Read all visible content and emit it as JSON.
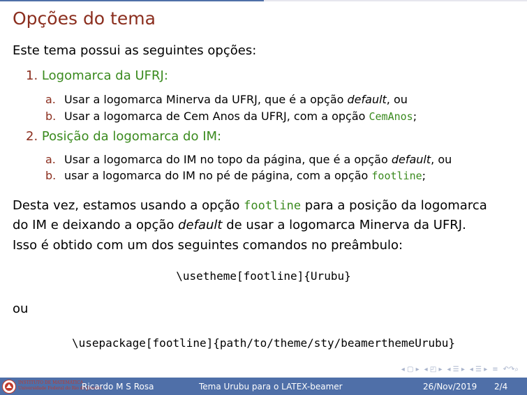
{
  "slide": {
    "title": "Opções do tema",
    "intro": "Este tema possui as seguintes opções:",
    "items": [
      {
        "num": "1.",
        "label": "Logomarca da UFRJ:",
        "subs": [
          {
            "letter": "a.",
            "pre": "Usar a logomarca Minerva da UFRJ, que é a opção ",
            "em": "default",
            "post": ", ou"
          },
          {
            "letter": "b.",
            "pre": "Usar a logomarca de Cem Anos da UFRJ, com a opção ",
            "code": "CemAnos",
            "post": ";"
          }
        ]
      },
      {
        "num": "2.",
        "label": "Posição da logomarca do IM:",
        "subs": [
          {
            "letter": "a.",
            "pre": "Usar a logomarca do IM no topo da página, que é a opção ",
            "em": "default",
            "post": ", ou"
          },
          {
            "letter": "b.",
            "pre": "usar a logomarca do IM no pé de página, com a opção ",
            "code": "footline",
            "post": ";"
          }
        ]
      }
    ],
    "paragraph": {
      "l1_pre": "Desta vez, estamos usando a opção ",
      "l1_code": "footline",
      "l1_post": " para a posição da logomarca",
      "l2_pre": "do IM e deixando a opção ",
      "l2_em": "default",
      "l2_post": " de usar a logomarca Minerva da UFRJ.",
      "l3": "Isso é obtido com um dos seguintes comandos no preâmbulo:"
    },
    "code1": "\\usetheme[footline]{Urubu}",
    "or_text": "ou",
    "code2": "\\usepackage[footline]{path/to/theme/sty/beamerthemeUrubu}"
  },
  "footer": {
    "institute_line1": "INSTITUTO DE MATEMÁTICA",
    "institute_line2": "Universidade Federal do Rio de Janeiro",
    "author": "Ricardo M S Rosa",
    "title_pre": "Tema Urubu para o ",
    "title_latex": "LATEX",
    "title_post": "-beamer",
    "date": "26/Nov/2019",
    "page": "2/4"
  },
  "colors": {
    "title": "#8b2e1e",
    "item_label": "#3a8a1e",
    "footer_bg": "#4f6fa8"
  },
  "icons": [
    "logo-icon",
    "nav-prev-frame-icon",
    "nav-prev-subsection-icon",
    "nav-section-icon",
    "nav-subsection-icon",
    "nav-align-icon",
    "nav-search-icon"
  ]
}
